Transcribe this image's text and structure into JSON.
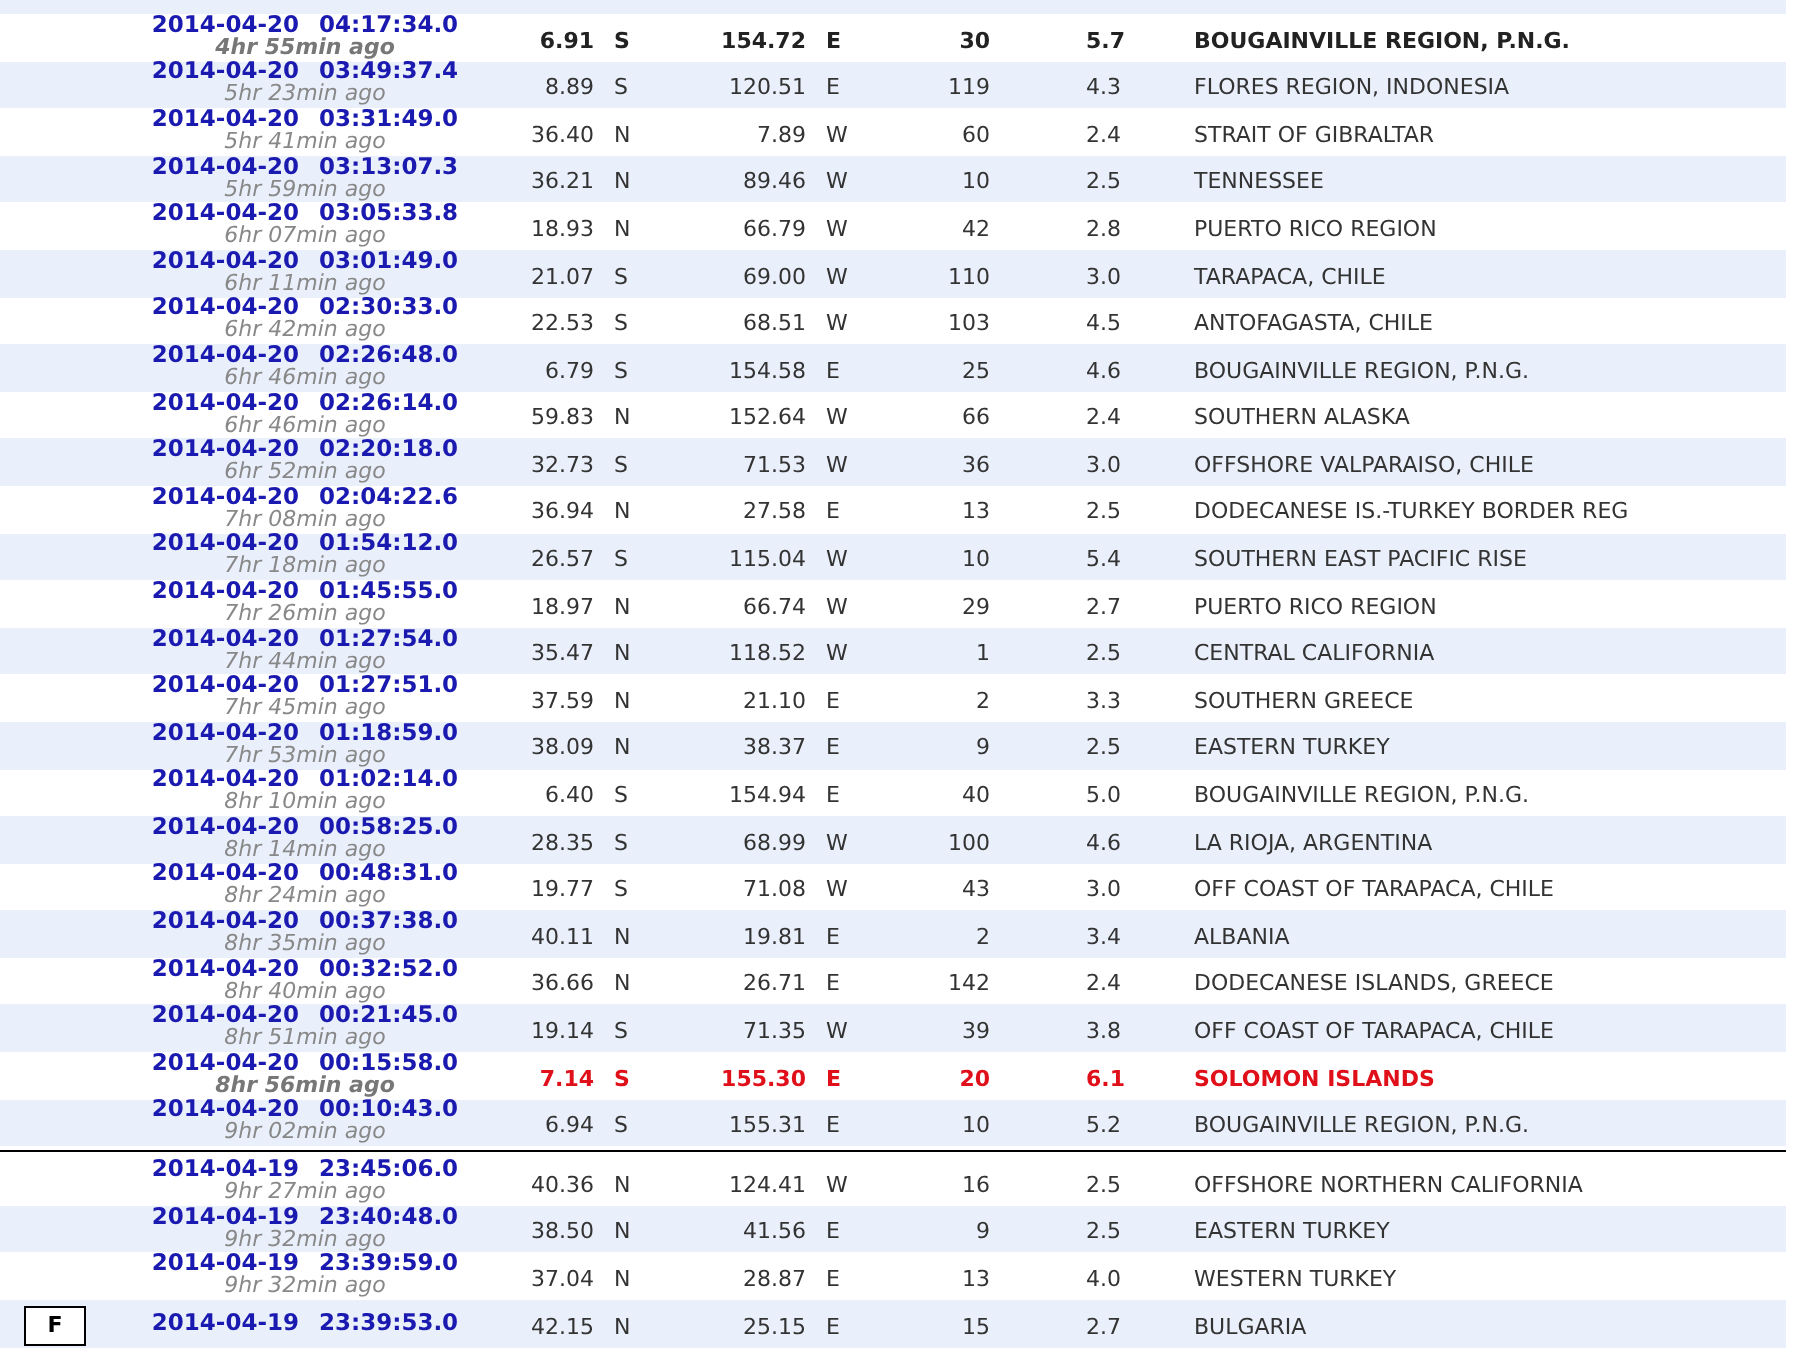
{
  "groups": [
    {
      "rows": [
        {
          "date": "2014-04-20",
          "time": "04:17:34.0",
          "ago": "4hr 55min ago",
          "lat": "6.91",
          "lat_dir": "S",
          "lon": "154.72",
          "lon_dir": "E",
          "depth": "30",
          "mag": "5.7",
          "region": "BOUGAINVILLE REGION, P.N.G.",
          "kind": "bold"
        },
        {
          "date": "2014-04-20",
          "time": "03:49:37.4",
          "ago": "5hr 23min ago",
          "lat": "8.89",
          "lat_dir": "S",
          "lon": "120.51",
          "lon_dir": "E",
          "depth": "119",
          "mag": "4.3",
          "region": "FLORES REGION, INDONESIA",
          "kind": "normal"
        },
        {
          "date": "2014-04-20",
          "time": "03:31:49.0",
          "ago": "5hr 41min ago",
          "lat": "36.40",
          "lat_dir": "N",
          "lon": "7.89",
          "lon_dir": "W",
          "depth": "60",
          "mag": "2.4",
          "region": "STRAIT OF GIBRALTAR",
          "kind": "normal"
        },
        {
          "date": "2014-04-20",
          "time": "03:13:07.3",
          "ago": "5hr 59min ago",
          "lat": "36.21",
          "lat_dir": "N",
          "lon": "89.46",
          "lon_dir": "W",
          "depth": "10",
          "mag": "2.5",
          "region": "TENNESSEE",
          "kind": "normal"
        },
        {
          "date": "2014-04-20",
          "time": "03:05:33.8",
          "ago": "6hr 07min ago",
          "lat": "18.93",
          "lat_dir": "N",
          "lon": "66.79",
          "lon_dir": "W",
          "depth": "42",
          "mag": "2.8",
          "region": "PUERTO RICO REGION",
          "kind": "normal"
        },
        {
          "date": "2014-04-20",
          "time": "03:01:49.0",
          "ago": "6hr 11min ago",
          "lat": "21.07",
          "lat_dir": "S",
          "lon": "69.00",
          "lon_dir": "W",
          "depth": "110",
          "mag": "3.0",
          "region": "TARAPACA, CHILE",
          "kind": "normal"
        },
        {
          "date": "2014-04-20",
          "time": "02:30:33.0",
          "ago": "6hr 42min ago",
          "lat": "22.53",
          "lat_dir": "S",
          "lon": "68.51",
          "lon_dir": "W",
          "depth": "103",
          "mag": "4.5",
          "region": "ANTOFAGASTA, CHILE",
          "kind": "normal"
        },
        {
          "date": "2014-04-20",
          "time": "02:26:48.0",
          "ago": "6hr 46min ago",
          "lat": "6.79",
          "lat_dir": "S",
          "lon": "154.58",
          "lon_dir": "E",
          "depth": "25",
          "mag": "4.6",
          "region": "BOUGAINVILLE REGION, P.N.G.",
          "kind": "normal"
        },
        {
          "date": "2014-04-20",
          "time": "02:26:14.0",
          "ago": "6hr 46min ago",
          "lat": "59.83",
          "lat_dir": "N",
          "lon": "152.64",
          "lon_dir": "W",
          "depth": "66",
          "mag": "2.4",
          "region": "SOUTHERN ALASKA",
          "kind": "normal"
        },
        {
          "date": "2014-04-20",
          "time": "02:20:18.0",
          "ago": "6hr 52min ago",
          "lat": "32.73",
          "lat_dir": "S",
          "lon": "71.53",
          "lon_dir": "W",
          "depth": "36",
          "mag": "3.0",
          "region": "OFFSHORE VALPARAISO, CHILE",
          "kind": "normal"
        },
        {
          "date": "2014-04-20",
          "time": "02:04:22.6",
          "ago": "7hr 08min ago",
          "lat": "36.94",
          "lat_dir": "N",
          "lon": "27.58",
          "lon_dir": "E",
          "depth": "13",
          "mag": "2.5",
          "region": "DODECANESE IS.-TURKEY BORDER REG",
          "kind": "normal"
        },
        {
          "date": "2014-04-20",
          "time": "01:54:12.0",
          "ago": "7hr 18min ago",
          "lat": "26.57",
          "lat_dir": "S",
          "lon": "115.04",
          "lon_dir": "W",
          "depth": "10",
          "mag": "5.4",
          "region": "SOUTHERN EAST PACIFIC RISE",
          "kind": "normal"
        },
        {
          "date": "2014-04-20",
          "time": "01:45:55.0",
          "ago": "7hr 26min ago",
          "lat": "18.97",
          "lat_dir": "N",
          "lon": "66.74",
          "lon_dir": "W",
          "depth": "29",
          "mag": "2.7",
          "region": "PUERTO RICO REGION",
          "kind": "normal"
        },
        {
          "date": "2014-04-20",
          "time": "01:27:54.0",
          "ago": "7hr 44min ago",
          "lat": "35.47",
          "lat_dir": "N",
          "lon": "118.52",
          "lon_dir": "W",
          "depth": "1",
          "mag": "2.5",
          "region": "CENTRAL CALIFORNIA",
          "kind": "normal"
        },
        {
          "date": "2014-04-20",
          "time": "01:27:51.0",
          "ago": "7hr 45min ago",
          "lat": "37.59",
          "lat_dir": "N",
          "lon": "21.10",
          "lon_dir": "E",
          "depth": "2",
          "mag": "3.3",
          "region": "SOUTHERN GREECE",
          "kind": "normal"
        },
        {
          "date": "2014-04-20",
          "time": "01:18:59.0",
          "ago": "7hr 53min ago",
          "lat": "38.09",
          "lat_dir": "N",
          "lon": "38.37",
          "lon_dir": "E",
          "depth": "9",
          "mag": "2.5",
          "region": "EASTERN TURKEY",
          "kind": "normal"
        },
        {
          "date": "2014-04-20",
          "time": "01:02:14.0",
          "ago": "8hr 10min ago",
          "lat": "6.40",
          "lat_dir": "S",
          "lon": "154.94",
          "lon_dir": "E",
          "depth": "40",
          "mag": "5.0",
          "region": "BOUGAINVILLE REGION, P.N.G.",
          "kind": "normal"
        },
        {
          "date": "2014-04-20",
          "time": "00:58:25.0",
          "ago": "8hr 14min ago",
          "lat": "28.35",
          "lat_dir": "S",
          "lon": "68.99",
          "lon_dir": "W",
          "depth": "100",
          "mag": "4.6",
          "region": "LA RIOJA, ARGENTINA",
          "kind": "normal"
        },
        {
          "date": "2014-04-20",
          "time": "00:48:31.0",
          "ago": "8hr 24min ago",
          "lat": "19.77",
          "lat_dir": "S",
          "lon": "71.08",
          "lon_dir": "W",
          "depth": "43",
          "mag": "3.0",
          "region": "OFF COAST OF TARAPACA, CHILE",
          "kind": "normal"
        },
        {
          "date": "2014-04-20",
          "time": "00:37:38.0",
          "ago": "8hr 35min ago",
          "lat": "40.11",
          "lat_dir": "N",
          "lon": "19.81",
          "lon_dir": "E",
          "depth": "2",
          "mag": "3.4",
          "region": "ALBANIA",
          "kind": "normal"
        },
        {
          "date": "2014-04-20",
          "time": "00:32:52.0",
          "ago": "8hr 40min ago",
          "lat": "36.66",
          "lat_dir": "N",
          "lon": "26.71",
          "lon_dir": "E",
          "depth": "142",
          "mag": "2.4",
          "region": "DODECANESE ISLANDS, GREECE",
          "kind": "normal"
        },
        {
          "date": "2014-04-20",
          "time": "00:21:45.0",
          "ago": "8hr 51min ago",
          "lat": "19.14",
          "lat_dir": "S",
          "lon": "71.35",
          "lon_dir": "W",
          "depth": "39",
          "mag": "3.8",
          "region": "OFF COAST OF TARAPACA, CHILE",
          "kind": "normal"
        },
        {
          "date": "2014-04-20",
          "time": "00:15:58.0",
          "ago": "8hr 56min ago",
          "lat": "7.14",
          "lat_dir": "S",
          "lon": "155.30",
          "lon_dir": "E",
          "depth": "20",
          "mag": "6.1",
          "region": "SOLOMON ISLANDS",
          "kind": "alert"
        },
        {
          "date": "2014-04-20",
          "time": "00:10:43.0",
          "ago": "9hr 02min ago",
          "lat": "6.94",
          "lat_dir": "S",
          "lon": "155.31",
          "lon_dir": "E",
          "depth": "10",
          "mag": "5.2",
          "region": "BOUGAINVILLE REGION, P.N.G.",
          "kind": "normal"
        }
      ]
    },
    {
      "rows": [
        {
          "date": "2014-04-19",
          "time": "23:45:06.0",
          "ago": "9hr 27min ago",
          "lat": "40.36",
          "lat_dir": "N",
          "lon": "124.41",
          "lon_dir": "W",
          "depth": "16",
          "mag": "2.5",
          "region": "OFFSHORE NORTHERN CALIFORNIA",
          "kind": "normal"
        },
        {
          "date": "2014-04-19",
          "time": "23:40:48.0",
          "ago": "9hr 32min ago",
          "lat": "38.50",
          "lat_dir": "N",
          "lon": "41.56",
          "lon_dir": "E",
          "depth": "9",
          "mag": "2.5",
          "region": "EASTERN TURKEY",
          "kind": "normal"
        },
        {
          "date": "2014-04-19",
          "time": "23:39:59.0",
          "ago": "9hr 32min ago",
          "lat": "37.04",
          "lat_dir": "N",
          "lon": "28.87",
          "lon_dir": "E",
          "depth": "13",
          "mag": "4.0",
          "region": "WESTERN TURKEY",
          "kind": "normal"
        },
        {
          "date": "2014-04-19",
          "time": "23:39:53.0",
          "lat": "42.15",
          "lat_dir": "N",
          "lon": "25.15",
          "lon_dir": "E",
          "depth": "15",
          "mag": "2.7",
          "region": "BULGARIA",
          "kind": "normal"
        }
      ]
    }
  ],
  "corner_button": "F"
}
